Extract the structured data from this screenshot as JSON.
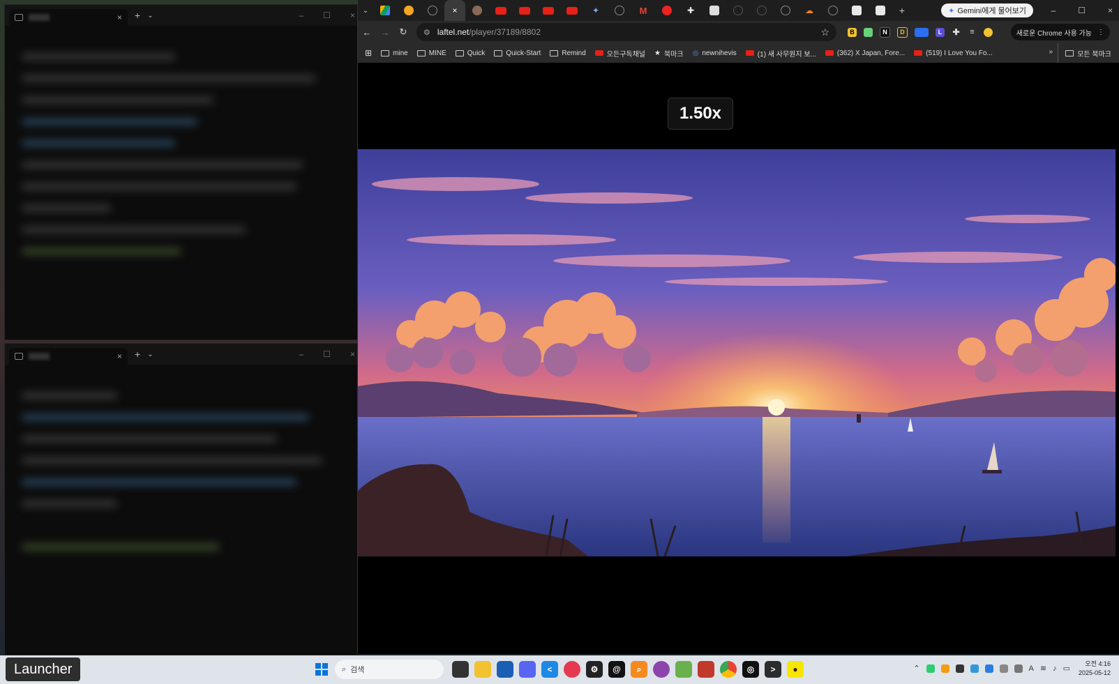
{
  "terminals": [
    {
      "tab_close": "×",
      "new_tab": "+",
      "dropdown": "⌄",
      "controls": [
        "–",
        "☐",
        "×"
      ]
    },
    {
      "tab_close": "×",
      "new_tab": "+",
      "dropdown": "⌄",
      "controls": [
        "–",
        "☐",
        "×"
      ]
    }
  ],
  "chrome": {
    "active_tab_close": "×",
    "new_tab": "+",
    "gemini_button": "Gemini에게 물어보기",
    "window_controls": [
      "–",
      "☐",
      "×"
    ],
    "url_host": "laftel.net",
    "url_path": "/player/37189/8802",
    "promo": "새로운 Chrome 사용 가능",
    "bookmarks": [
      {
        "label": "mine",
        "icon": "folder-icon"
      },
      {
        "label": "MINE",
        "icon": "folder-icon"
      },
      {
        "label": "Quick",
        "icon": "folder-icon"
      },
      {
        "label": "Quick-Start",
        "icon": "folder-icon"
      },
      {
        "label": "Remind",
        "icon": "folder-icon"
      },
      {
        "label": "오든구독채널",
        "icon": "youtube-icon"
      },
      {
        "label": "북마크",
        "icon": "star-icon"
      },
      {
        "label": "newnihevis",
        "icon": "globe-icon"
      },
      {
        "label": "(1) 새 사무원지 보...",
        "icon": "youtube-icon"
      },
      {
        "label": "(362) X Japan, Fore...",
        "icon": "youtube-icon"
      },
      {
        "label": "(519) I Love You Fo...",
        "icon": "youtube-icon"
      }
    ],
    "more_bookmarks": "»",
    "all_bookmarks": "모든 북마크",
    "playback_speed": "1.50x"
  },
  "taskbar": {
    "launcher": "Launcher",
    "search_placeholder": "검색",
    "time": "오전 4:16",
    "date": "2025-05-12"
  },
  "colors": {
    "sky_top": "#4a56b8",
    "sky_mid": "#d8688a",
    "horizon": "#ffb347",
    "sea": "#3a4fa6",
    "accent_blue": "#0a74da"
  }
}
